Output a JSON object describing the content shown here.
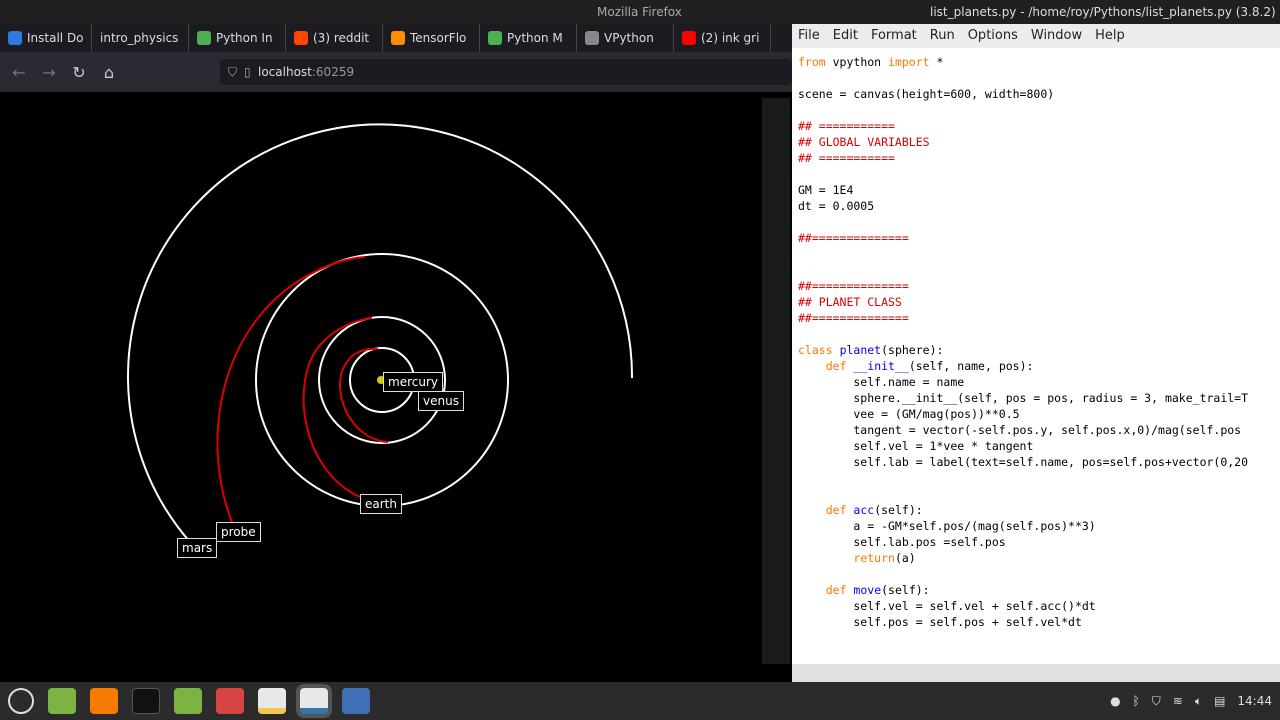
{
  "firefox": {
    "title": "Mozilla Firefox",
    "url_host": "localhost",
    "url_port": ":60259",
    "tabs": [
      {
        "label": "Install Do",
        "color": "#2a7ae2"
      },
      {
        "label": "intro_physics",
        "color": ""
      },
      {
        "label": "Python In",
        "color": "#4caf50"
      },
      {
        "label": "(3) reddit",
        "color": "#ff4500"
      },
      {
        "label": "TensorFlo",
        "color": "#ff8f00"
      },
      {
        "label": "Python M",
        "color": "#4caf50"
      },
      {
        "label": "VPython",
        "color": "#888"
      },
      {
        "label": "(2) ink gri",
        "color": "#ff0000"
      }
    ]
  },
  "scene": {
    "labels": {
      "mercury": "mercury",
      "venus": "venus",
      "earth": "earth",
      "probe": "probe",
      "mars": "mars"
    }
  },
  "idle": {
    "title": "list_planets.py - /home/roy/Pythons/list_planets.py (3.8.2)",
    "menu": [
      "File",
      "Edit",
      "Format",
      "Run",
      "Options",
      "Window",
      "Help"
    ],
    "code": [
      [
        [
          "from",
          "k"
        ],
        [
          " vpython ",
          ""
        ],
        [
          "import",
          "k"
        ],
        [
          " *",
          ""
        ]
      ],
      [],
      [
        [
          "scene = canvas(height=600, width=800)",
          ""
        ]
      ],
      [],
      [
        [
          "## ===========",
          "c"
        ]
      ],
      [
        [
          "## GLOBAL VARIABLES",
          "c"
        ]
      ],
      [
        [
          "## ===========",
          "c"
        ]
      ],
      [],
      [
        [
          "GM = 1E4",
          ""
        ]
      ],
      [
        [
          "dt = 0.0005",
          ""
        ]
      ],
      [],
      [
        [
          "##==============",
          "c"
        ]
      ],
      [],
      [],
      [
        [
          "##==============",
          "c"
        ]
      ],
      [
        [
          "## PLANET CLASS",
          "c"
        ]
      ],
      [
        [
          "##==============",
          "c"
        ]
      ],
      [],
      [
        [
          "class",
          "k"
        ],
        [
          " ",
          ""
        ],
        [
          "planet",
          "d"
        ],
        [
          "(sphere):",
          ""
        ]
      ],
      [
        [
          "    ",
          ""
        ],
        [
          "def",
          "k"
        ],
        [
          " ",
          ""
        ],
        [
          "__init__",
          "d"
        ],
        [
          "(self, name, pos):",
          ""
        ]
      ],
      [
        [
          "        self.name = name",
          ""
        ]
      ],
      [
        [
          "        sphere.__init__(self, pos = pos, radius = 3, make_trail=T",
          ""
        ]
      ],
      [
        [
          "        vee = (GM/mag(pos))**0.5",
          ""
        ]
      ],
      [
        [
          "        tangent = vector(-self.pos.y, self.pos.x,0)/mag(self.pos",
          ""
        ]
      ],
      [
        [
          "        self.vel = 1*vee * tangent",
          ""
        ]
      ],
      [
        [
          "        self.lab = label(text=self.name, pos=self.pos+vector(0,20",
          ""
        ]
      ],
      [],
      [],
      [
        [
          "    ",
          ""
        ],
        [
          "def",
          "k"
        ],
        [
          " ",
          ""
        ],
        [
          "acc",
          "d"
        ],
        [
          "(self):",
          ""
        ]
      ],
      [
        [
          "        a = -GM*self.pos/(mag(self.pos)**3)",
          ""
        ]
      ],
      [
        [
          "        self.lab.pos =self.pos",
          ""
        ]
      ],
      [
        [
          "        ",
          ""
        ],
        [
          "return",
          "k"
        ],
        [
          "(a)",
          ""
        ]
      ],
      [],
      [
        [
          "    ",
          ""
        ],
        [
          "def",
          "k"
        ],
        [
          " ",
          ""
        ],
        [
          "move",
          "d"
        ],
        [
          "(self):",
          ""
        ]
      ],
      [
        [
          "        self.vel = self.vel + self.acc()*dt",
          ""
        ]
      ],
      [
        [
          "        self.pos = self.pos + self.vel*dt",
          ""
        ]
      ]
    ]
  },
  "taskbar": {
    "clock": "14:44"
  }
}
